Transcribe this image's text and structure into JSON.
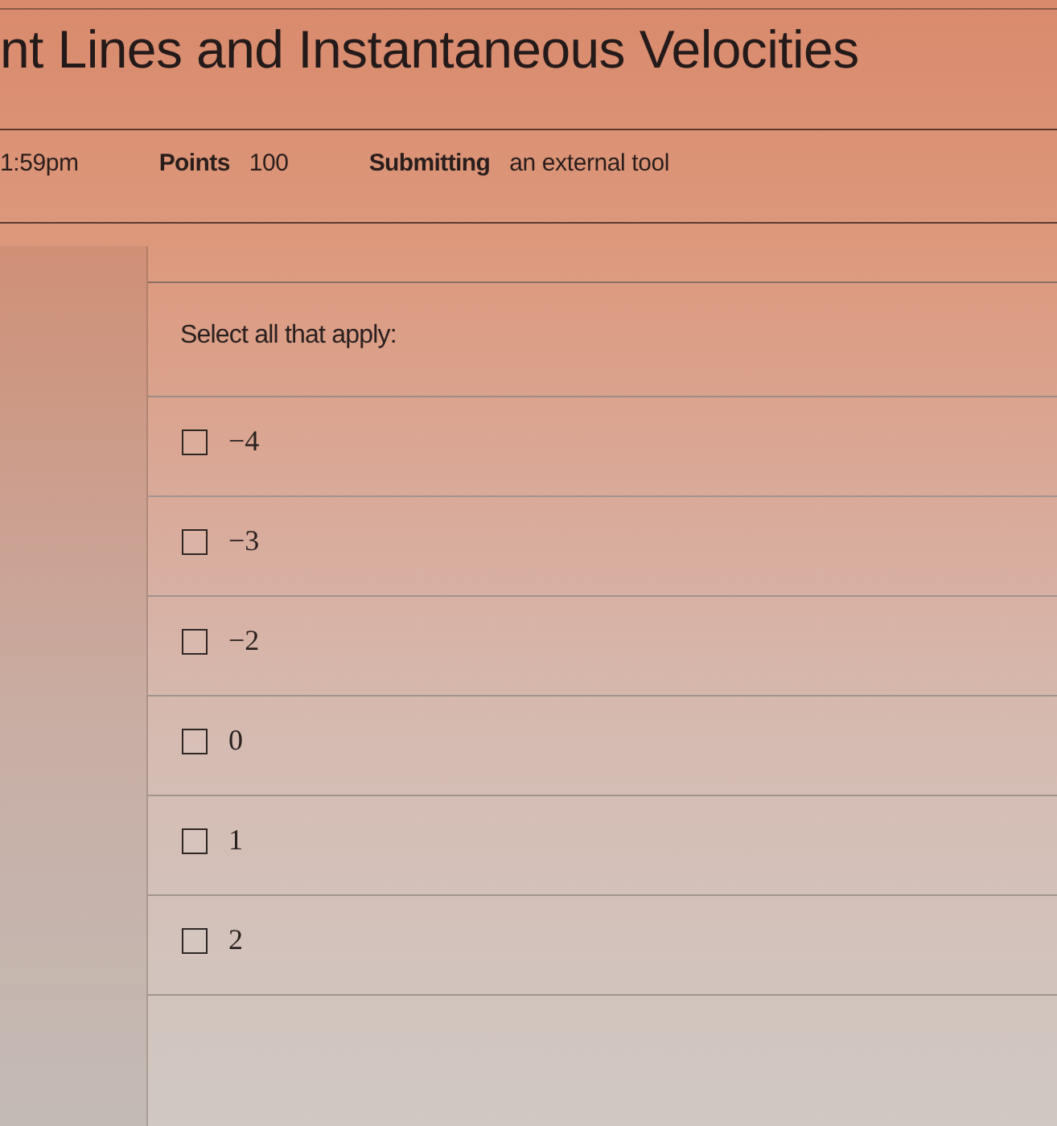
{
  "header": {
    "title": "nt Lines and Instantaneous Velocities"
  },
  "details": [
    {
      "value": "1:59pm"
    },
    {
      "label": "Points",
      "value": "100"
    },
    {
      "label": "Submitting",
      "value": "an external tool"
    }
  ],
  "question": {
    "prompt": "Select all that apply:",
    "options": [
      {
        "label": "−4",
        "checked": false
      },
      {
        "label": "−3",
        "checked": false
      },
      {
        "label": "−2",
        "checked": false
      },
      {
        "label": "0",
        "checked": false
      },
      {
        "label": "1",
        "checked": false
      },
      {
        "label": "2",
        "checked": false
      }
    ]
  }
}
